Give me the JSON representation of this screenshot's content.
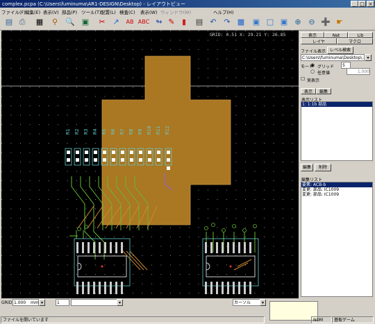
{
  "window": {
    "title": "complex.pcpa (C:\\Users\\fuminuma\\AR1-DESIGN\\Desktop) - レイアウトビュー",
    "minimize": "_",
    "maximize": "□",
    "close": "×"
  },
  "menu": [
    "ファイル(F)",
    "編集(E)",
    "表示(V)",
    "部品(P)",
    "ツール(T)",
    "配置(L)",
    "検査(C)",
    "表示(W)",
    "ウィンドウ(W)",
    "ヘルプ(H)"
  ],
  "canvas": {
    "readout": "GRID: 0.51  X: 29.21 Y: 26.85"
  },
  "panel": {
    "tabs_top": [
      "表示",
      "Net",
      "Lib"
    ],
    "tab_mid": [
      "レイヤ",
      "マクロ"
    ],
    "file_label": "ファイル表示",
    "refresh_button": "レベル検索",
    "path_value": "C:\\Users\\fuminuma\\Desktop\\...",
    "mode_label": "モード",
    "grid_radio": "グリッド",
    "grid_value": "5",
    "any_radio": "任意値",
    "any_value": "1.000",
    "realtime_check": "実表示",
    "tabs2": [
      "表示",
      "編集"
    ],
    "display_list_label": "表示リスト",
    "display_list": [
      "1: 1:1b 部品"
    ],
    "button_edit": "編集",
    "button_delete": "削除",
    "edit_list_label": "編集リスト",
    "edit_list": [
      "要素: ACB-b",
      "変更: 部品: IC1009",
      "変更: 部品: IC1009"
    ]
  },
  "bottom": {
    "grid_label": "GRID",
    "grid_value": "1.000",
    "grid_unit": "mm",
    "unit_value": "1",
    "cursor_label": "カーソル",
    "status_left": "ファイルを開いています",
    "status_mid": "NUM",
    "status_right": "基板ゲーム"
  },
  "colors": {
    "board_fill": "#aa7722",
    "trace_green": "#66bb33",
    "trace_orange": "#cc8833",
    "pad_cyan": "#66cccc",
    "title_bg": "#0a246a"
  }
}
